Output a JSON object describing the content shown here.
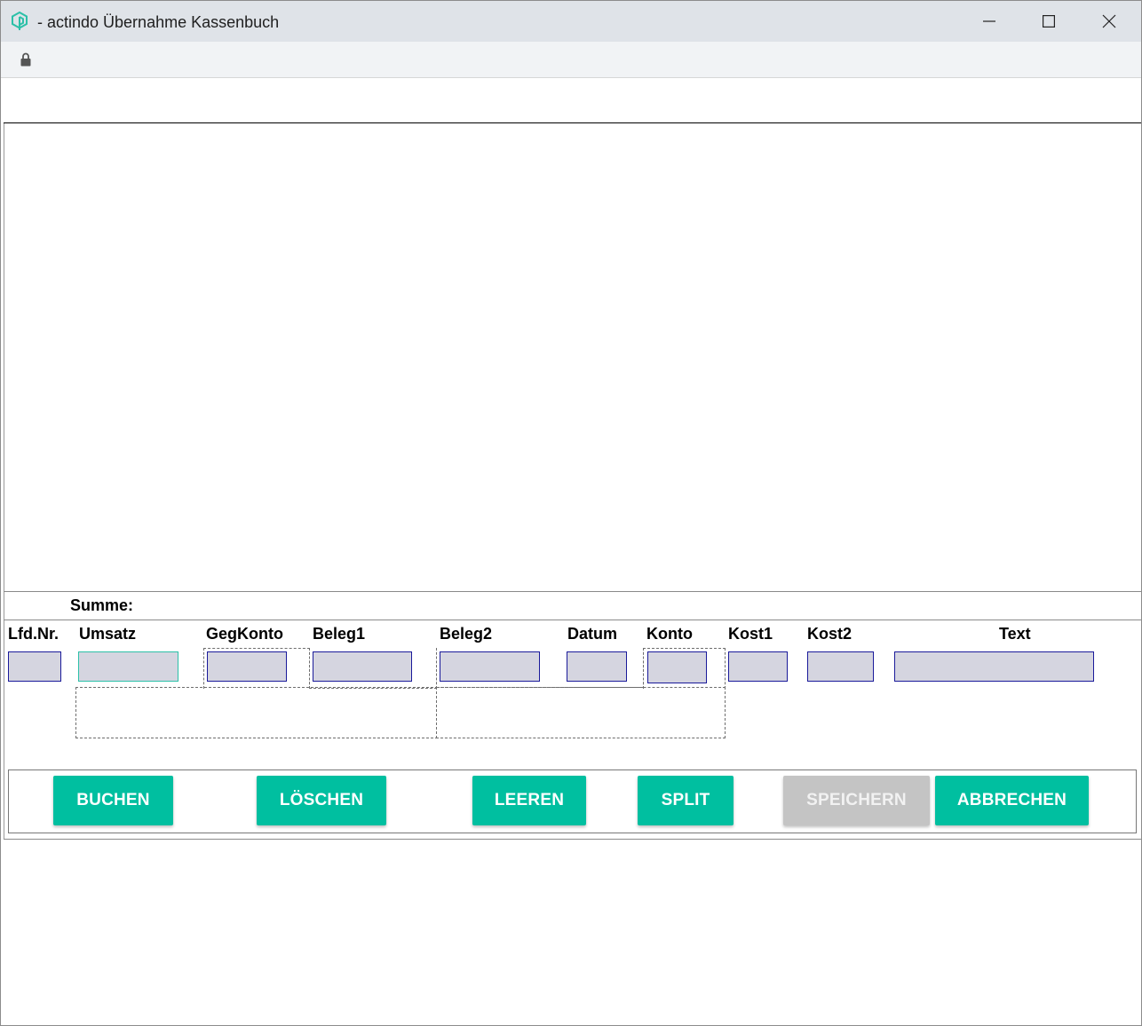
{
  "window": {
    "title": "- actindo Übernahme Kassenbuch",
    "icon": "actindo-logo-icon",
    "controls": [
      "minimize-icon",
      "maximize-icon",
      "close-icon"
    ]
  },
  "addressbar": {
    "icon": "lock-icon"
  },
  "summary": {
    "label": "Summe:"
  },
  "columns": {
    "lfdnr": "Lfd.Nr.",
    "umsatz": "Umsatz",
    "gegkonto": "GegKonto",
    "beleg1": "Beleg1",
    "beleg2": "Beleg2",
    "datum": "Datum",
    "konto": "Konto",
    "kost1": "Kost1",
    "kost2": "Kost2",
    "text": "Text"
  },
  "fields": {
    "lfdnr": "",
    "umsatz": "",
    "gegkonto": "",
    "beleg1": "",
    "beleg2": "",
    "datum": "",
    "konto": "",
    "kost1": "",
    "kost2": "",
    "text": ""
  },
  "buttons": {
    "buchen": "BUCHEN",
    "loeschen": "LÖSCHEN",
    "leeren": "LEEREN",
    "split": "SPLIT",
    "speichern": "SPEICHERN",
    "abbrechen": "ABBRECHEN"
  },
  "colors": {
    "accent": "#00bfa0",
    "field_bg": "#d5d5e0",
    "field_border": "#1a1a9a",
    "disabled": "#c4c4c4",
    "titlebar": "#dfe3e8"
  }
}
